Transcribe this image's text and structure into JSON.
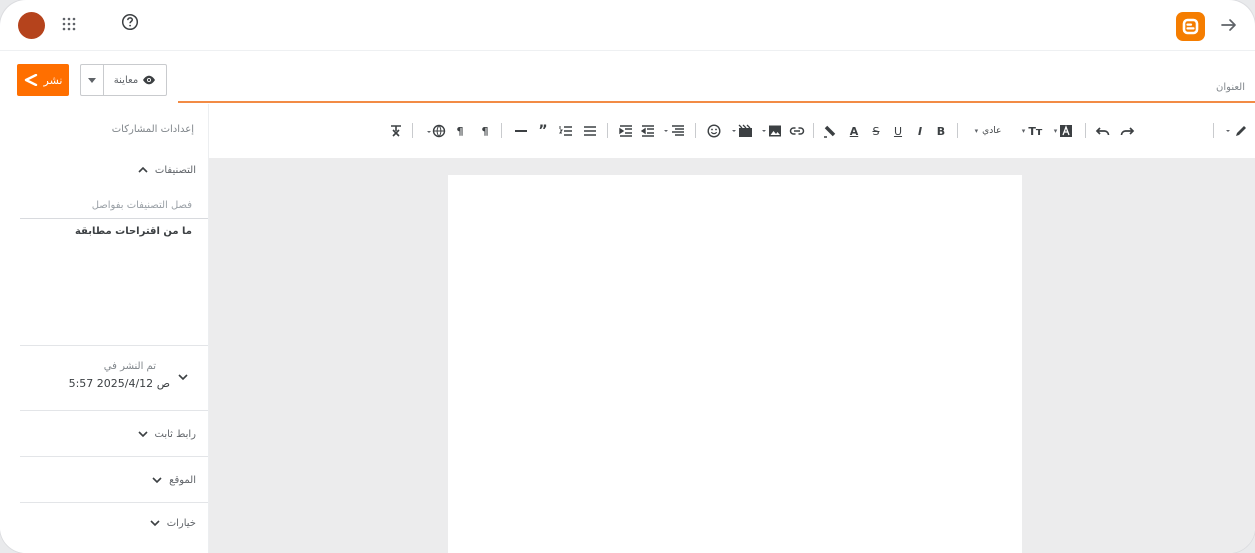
{
  "topbar": {
    "avatar_color": "#b5431c",
    "apps_icon": "apps-grid-icon",
    "help_icon": "help-icon",
    "logo_icon": "blogger-logo",
    "back_icon": "arrow-right-icon"
  },
  "actions": {
    "publish_label": "نشر",
    "preview_label": "معاينة"
  },
  "title": {
    "placeholder": "العنوان"
  },
  "sidebar": {
    "heading": "إعدادات المشاركات",
    "labels_section": "التصنيفات",
    "labels_placeholder": "فصل التصنيفات بفواصل",
    "labels_suggestion": "ما من اقتراحات مطابقة",
    "published_label": "تم النشر في",
    "published_value": "5:57 2025/4/12 ص",
    "permalink": "رابط ثابت",
    "location": "الموقع",
    "options": "خيارات"
  },
  "toolbar": {
    "format_label": "عادي",
    "bold": "B",
    "italic": "I",
    "underline": "U",
    "strike": "S",
    "font_color": "A",
    "font_size": "Tт"
  },
  "colors": {
    "accent": "#ff6f00",
    "title_underline": "#f28b45",
    "editor_bg": "#ececed"
  }
}
